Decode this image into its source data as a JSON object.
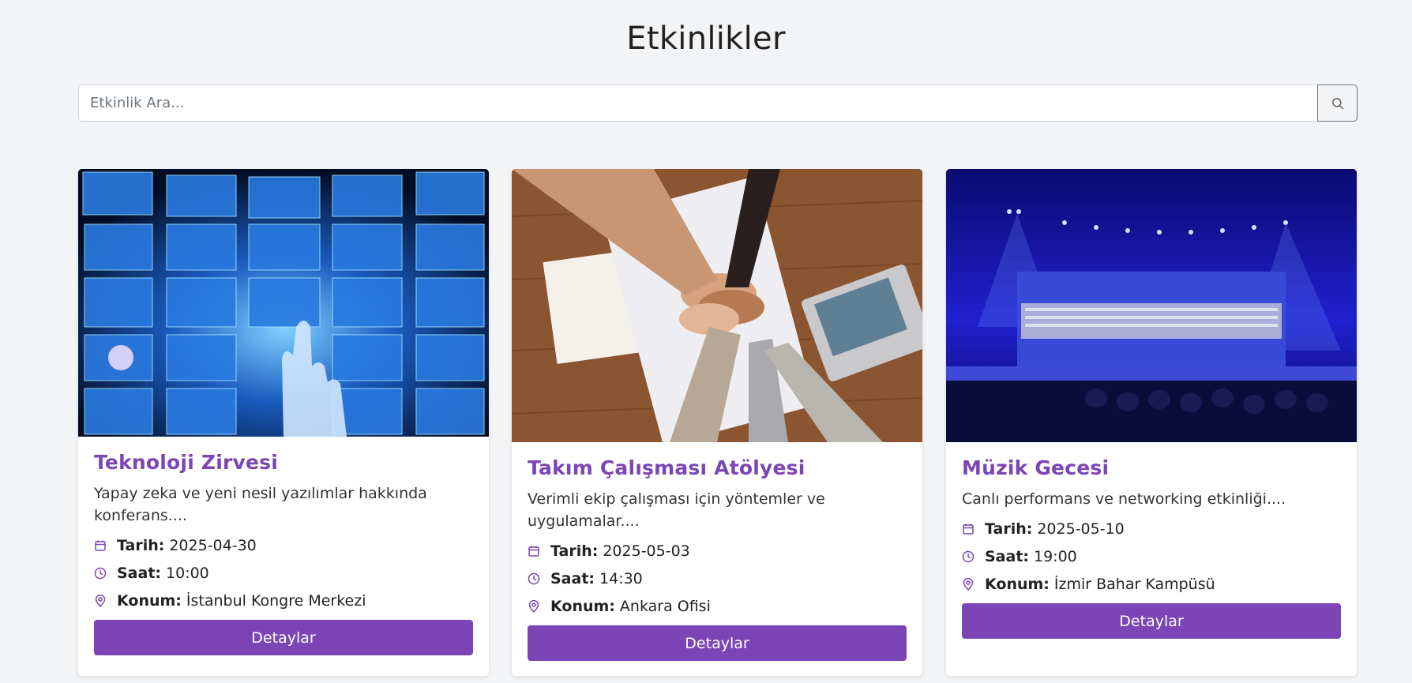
{
  "page": {
    "title": "Etkinlikler"
  },
  "search": {
    "placeholder": "Etkinlik Ara..."
  },
  "labels": {
    "date": "Tarih:",
    "time": "Saat:",
    "location": "Konum:",
    "details": "Detaylar"
  },
  "colors": {
    "accent": "#7b45b5",
    "background": "#f3f4f6"
  },
  "events": [
    {
      "title": "Teknoloji Zirvesi",
      "description": "Yapay zeka ve yeni nesil yazılımlar hakkında konferans....",
      "date": "2025-04-30",
      "time": "10:00",
      "location": "İstanbul Kongre Merkezi",
      "image": "futuristic-screens-photo"
    },
    {
      "title": "Takım Çalışması Atölyesi",
      "description": "Verimli ekip çalışması için yöntemler ve uygulamalar....",
      "date": "2025-05-03",
      "time": "14:30",
      "location": "Ankara Ofisi",
      "image": "hands-together-photo"
    },
    {
      "title": "Müzik Gecesi",
      "description": "Canlı performans ve networking etkinliği....",
      "date": "2025-05-10",
      "time": "19:00",
      "location": "İzmir Bahar Kampüsü",
      "image": "concert-stage-photo"
    }
  ],
  "icons": {
    "search": "search-icon",
    "calendar": "calendar-icon",
    "clock": "clock-icon",
    "location": "location-pin-icon"
  }
}
